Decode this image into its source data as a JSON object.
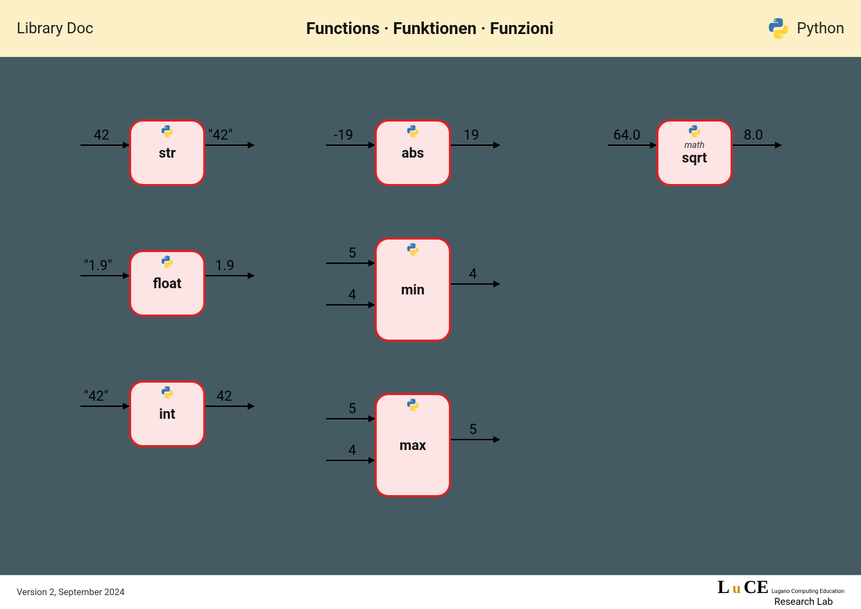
{
  "header": {
    "left_label": "Library Doc",
    "title": "Functions · Funktionen · Funzioni",
    "right_label": "Python"
  },
  "functions": {
    "str": {
      "name": "str",
      "inputs": [
        "42"
      ],
      "output": "\"42\""
    },
    "float": {
      "name": "float",
      "inputs": [
        "\"1.9\""
      ],
      "output": "1.9"
    },
    "int": {
      "name": "int",
      "inputs": [
        "\"42\""
      ],
      "output": "42"
    },
    "abs": {
      "name": "abs",
      "inputs": [
        "-19"
      ],
      "output": "19"
    },
    "min": {
      "name": "min",
      "inputs": [
        "5",
        "4"
      ],
      "output": "4"
    },
    "max": {
      "name": "max",
      "inputs": [
        "5",
        "4"
      ],
      "output": "5"
    },
    "sqrt": {
      "name": "sqrt",
      "module": "math",
      "inputs": [
        "64.0"
      ],
      "output": "8.0"
    }
  },
  "footer": {
    "version": "Version 2, September 2024",
    "lab_line1": "Lugano Computing Education",
    "lab_line2": "Research Lab"
  }
}
